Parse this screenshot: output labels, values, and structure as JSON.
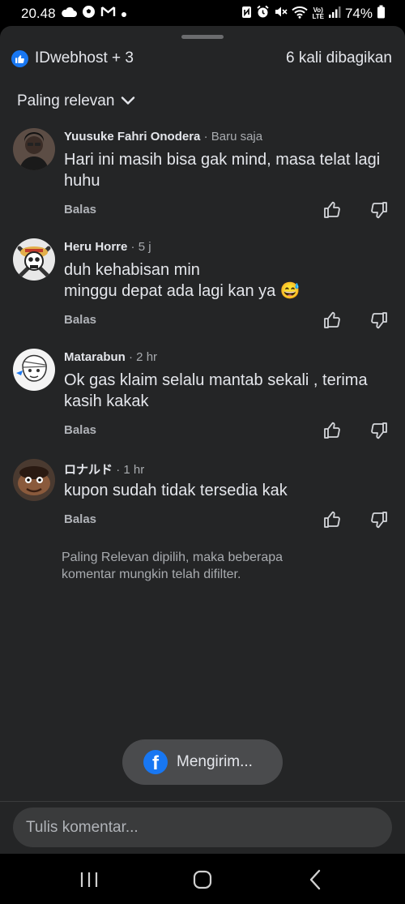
{
  "status": {
    "time": "20.48",
    "battery": "74%",
    "left_icons": [
      "cloud-icon",
      "soccer-ball-icon",
      "gmail-icon",
      "dot-icon"
    ],
    "right_icons": [
      "nfc-icon",
      "alarm-icon",
      "mute-icon",
      "wifi-icon",
      "volte-icon",
      "signal-icon",
      "battery-icon"
    ],
    "volte_label": "Vo)\nLTE"
  },
  "header": {
    "reactors": "IDwebhost + 3",
    "shares": "6 kali dibagikan"
  },
  "sort": {
    "label": "Paling relevan"
  },
  "comments": [
    {
      "author": "Yuusuke Fahri Onodera",
      "time": "· Baru saja",
      "text": "Hari ini masih bisa gak mind, masa telat lagi huhu",
      "reply": "Balas",
      "avatar": "person-photo"
    },
    {
      "author": "Heru Horre",
      "time": "· 5 j",
      "text": "duh kehabisan min\nminggu depat ada lagi kan ya 😅",
      "reply": "Balas",
      "avatar": "skull-straw-hat"
    },
    {
      "author": "Matarabun",
      "time": "· 2 hr",
      "text": "Ok gas klaim selalu mantab sekali , terima kasih kakak",
      "reply": "Balas",
      "avatar": "sketch-face"
    },
    {
      "author": "ロナルド",
      "time": "· 1 hr",
      "text": "kupon sudah tidak tersedia kak",
      "reply": "Balas",
      "avatar": "cartoon-character"
    }
  ],
  "filter_note": "Paling Relevan dipilih, maka beberapa komentar mungkin telah difilter.",
  "toast": {
    "label": "Mengirim..."
  },
  "composer": {
    "placeholder": "Tulis komentar..."
  },
  "colors": {
    "sheet_bg": "#242526",
    "accent": "#1877f2",
    "muted_text": "#a8abaf"
  }
}
